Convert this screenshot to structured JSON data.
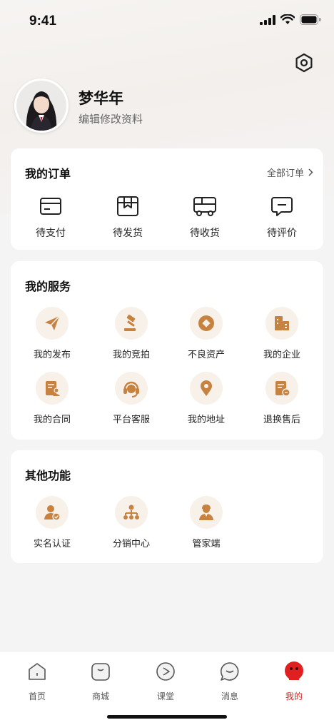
{
  "status_bar": {
    "time": "9:41"
  },
  "profile": {
    "name": "梦华年",
    "edit_label": "编辑修改资料"
  },
  "orders": {
    "title": "我的订单",
    "all_label": "全部订单",
    "items": [
      {
        "label": "待支付",
        "icon": "card-icon"
      },
      {
        "label": "待发货",
        "icon": "package-icon"
      },
      {
        "label": "待收货",
        "icon": "truck-icon"
      },
      {
        "label": "待评价",
        "icon": "comment-icon"
      }
    ]
  },
  "services": {
    "title": "我的服务",
    "items": [
      {
        "label": "我的发布",
        "icon": "paper-plane-icon"
      },
      {
        "label": "我的竞拍",
        "icon": "gavel-icon"
      },
      {
        "label": "不良资产",
        "icon": "diamond-icon"
      },
      {
        "label": "我的企业",
        "icon": "building-icon"
      },
      {
        "label": "我的合同",
        "icon": "contract-icon"
      },
      {
        "label": "平台客服",
        "icon": "headset-icon"
      },
      {
        "label": "我的地址",
        "icon": "location-pin-icon"
      },
      {
        "label": "退换售后",
        "icon": "return-doc-icon"
      }
    ]
  },
  "other": {
    "title": "其他功能",
    "items": [
      {
        "label": "实名认证",
        "icon": "user-verified-icon"
      },
      {
        "label": "分销中心",
        "icon": "org-chart-icon"
      },
      {
        "label": "管家端",
        "icon": "butler-icon"
      }
    ]
  },
  "tabbar": {
    "items": [
      {
        "label": "首页",
        "icon": "home-icon",
        "active": false
      },
      {
        "label": "商城",
        "icon": "shop-bag-icon",
        "active": false
      },
      {
        "label": "课堂",
        "icon": "play-icon",
        "active": false
      },
      {
        "label": "消息",
        "icon": "message-icon",
        "active": false
      },
      {
        "label": "我的",
        "icon": "profile-face-icon",
        "active": true
      }
    ]
  },
  "colors": {
    "accent": "#e02020",
    "service_icon": "#c8823f",
    "service_circle": "#f8f1ea"
  }
}
